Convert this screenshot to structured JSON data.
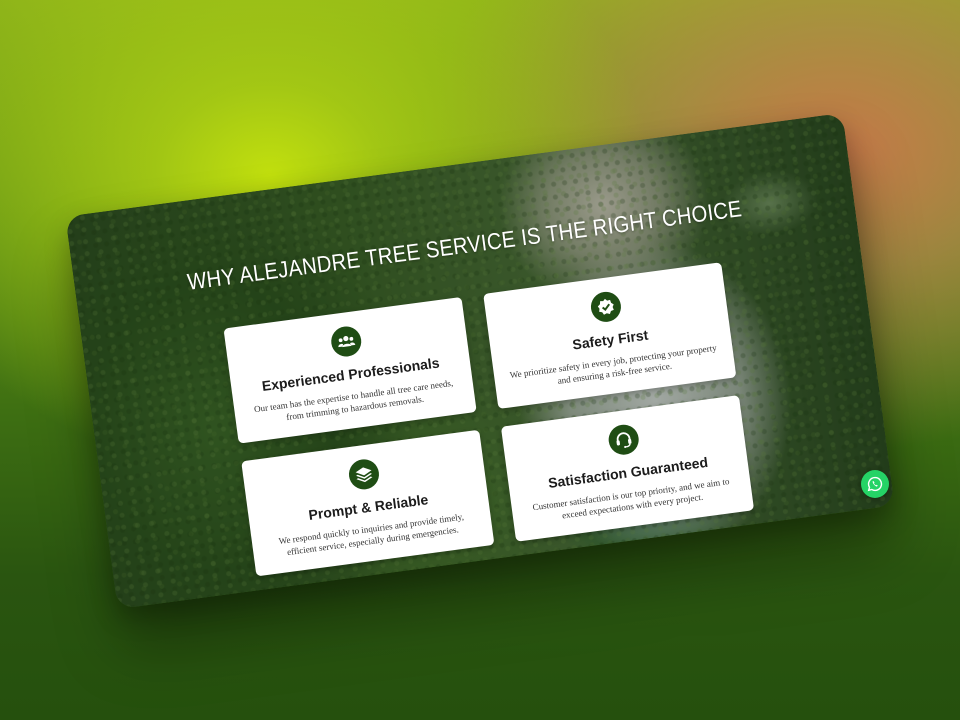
{
  "section": {
    "title": "WHY ALEJANDRE TREE SERVICE IS THE RIGHT CHOICE"
  },
  "cards": [
    {
      "icon": "users-icon",
      "title": "Experienced Professionals",
      "description": "Our team has the expertise to handle all tree care needs, from trimming to hazardous removals."
    },
    {
      "icon": "check-badge-icon",
      "title": "Safety First",
      "description": "We prioritize safety in every job, protecting your property and ensuring a risk-free service."
    },
    {
      "icon": "layers-icon",
      "title": "Prompt & Reliable",
      "description": "We respond quickly to inquiries and provide timely, efficient service, especially during emergencies."
    },
    {
      "icon": "headset-icon",
      "title": "Satisfaction Guaranteed",
      "description": "Customer satisfaction is our top priority, and we aim to exceed expectations with every project."
    }
  ],
  "colors": {
    "icon_background": "#1f4d14",
    "whatsapp": "#25d366"
  },
  "floating_button": {
    "icon": "whatsapp-icon"
  }
}
